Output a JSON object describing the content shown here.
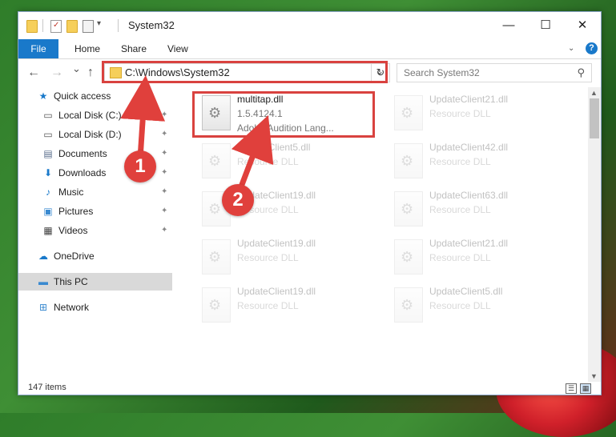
{
  "window": {
    "title": "System32",
    "controls": {
      "minimize": "—",
      "maximize": "☐",
      "close": "✕"
    }
  },
  "ribbon": {
    "tabs": [
      "File",
      "Home",
      "Share",
      "View"
    ],
    "help": "?"
  },
  "nav": {
    "back": "←",
    "forward": "→",
    "recent": "⌄",
    "up": "↑",
    "address": "C:\\Windows\\System32",
    "search_placeholder": "Search System32"
  },
  "sidebar": {
    "items": [
      {
        "label": "Quick access",
        "icon": "star-icon",
        "glyph": "★",
        "color": "#1979ca"
      },
      {
        "label": "Local Disk (C:)",
        "icon": "drive-icon",
        "glyph": "▭",
        "color": "#555555",
        "pinned": true
      },
      {
        "label": "Local Disk (D:)",
        "icon": "drive-icon",
        "glyph": "▭",
        "color": "#555555",
        "pinned": true
      },
      {
        "label": "Documents",
        "icon": "documents-icon",
        "glyph": "▤",
        "color": "#5a6e8c",
        "pinned": true
      },
      {
        "label": "Downloads",
        "icon": "download-arrow-icon",
        "glyph": "⬇",
        "color": "#1979ca",
        "pinned": true
      },
      {
        "label": "Music",
        "icon": "music-note-icon",
        "glyph": "♪",
        "color": "#1979ca",
        "pinned": true
      },
      {
        "label": "Pictures",
        "icon": "pictures-icon",
        "glyph": "▣",
        "color": "#3a8ad0",
        "pinned": true
      },
      {
        "label": "Videos",
        "icon": "film-icon",
        "glyph": "▦",
        "color": "#444444",
        "pinned": true
      },
      {
        "label": "OneDrive",
        "icon": "cloud-icon",
        "glyph": "☁",
        "color": "#1979ca"
      },
      {
        "label": "This PC",
        "icon": "computer-icon",
        "glyph": "▬",
        "color": "#3a8ad0",
        "selected": true
      },
      {
        "label": "Network",
        "icon": "network-icon",
        "glyph": "⊞",
        "color": "#3a8ad0"
      }
    ]
  },
  "files": {
    "highlighted": {
      "name": "multitap.dll",
      "version": "1.5.4124.1",
      "description": "Adobe Audition Lang..."
    },
    "faded": [
      {
        "name": "UpdateClient21.dll",
        "type": "Resource DLL"
      },
      {
        "name": "UpdateClient5.dll",
        "type": "Resource DLL"
      },
      {
        "name": "UpdateClient42.dll",
        "type": "Resource DLL"
      },
      {
        "name": "UpdateClient19.dll",
        "type": "Resource DLL"
      },
      {
        "name": "UpdateClient63.dll",
        "type": "Resource DLL"
      },
      {
        "name": "UpdateClient19.dll",
        "type": "Resource DLL"
      },
      {
        "name": "UpdateClient21.dll",
        "type": "Resource DLL"
      },
      {
        "name": "UpdateClient19.dll",
        "type": "Resource DLL"
      },
      {
        "name": "UpdateClient5.dll",
        "type": "Resource DLL"
      }
    ]
  },
  "status": {
    "item_count": "147 items"
  },
  "annotations": {
    "step1": "1",
    "step2": "2",
    "color": "#d9423f"
  }
}
